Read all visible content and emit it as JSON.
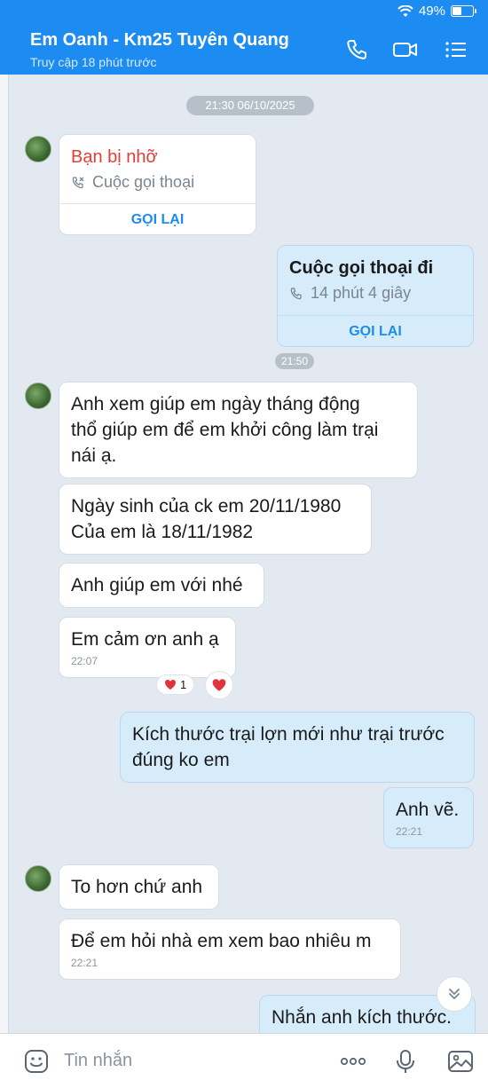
{
  "status": {
    "battery": "49%",
    "battery_level": 0.49
  },
  "header": {
    "title": "Em Oanh - Km25 Tuyên Quang",
    "subtitle": "Truy cập 18 phút trước",
    "icons": [
      "phone-icon",
      "video-icon",
      "menu-icon"
    ]
  },
  "chat": {
    "date_pill": "21:30 06/10/2025",
    "missed_call": {
      "title": "Bạn bị nhỡ",
      "sub": "Cuộc gọi thoại",
      "action": "GỌI LẠI"
    },
    "outgoing_call": {
      "title": "Cuộc gọi thoại đi",
      "sub": "14 phút 4 giây",
      "action": "GỌI LẠI"
    },
    "time_pill": "21:50",
    "messages": [
      {
        "dir": "in",
        "text_lines": [
          "Anh xem giúp em ngày tháng động",
          "thổ giúp em để em khởi công làm trại",
          "nái ạ."
        ]
      },
      {
        "dir": "in",
        "text_lines": [
          "Ngày sinh của ck em 20/11/1980",
          "Của em là 18/11/1982"
        ]
      },
      {
        "dir": "in",
        "text_lines": [
          "Anh giúp em với nhé"
        ]
      },
      {
        "dir": "in",
        "text_lines": [
          "Em cảm ơn anh ạ"
        ],
        "time": "22:07"
      },
      {
        "dir": "out",
        "text_lines": [
          "Kích thước trại lợn mới như trại trước",
          "đúng ko em"
        ]
      },
      {
        "dir": "out",
        "text_lines": [
          "Anh vẽ."
        ],
        "time": "22:21"
      },
      {
        "dir": "in",
        "text_lines": [
          "To hơn chứ anh"
        ]
      },
      {
        "dir": "in",
        "text_lines": [
          "Để em hỏi nhà em xem bao nhiêu m"
        ],
        "time": "22:21"
      },
      {
        "dir": "out",
        "text_lines": [
          "Nhắn anh kích thước."
        ]
      }
    ],
    "reaction": {
      "count": "1",
      "icon": "heart-icon"
    }
  },
  "input_bar": {
    "placeholder": "Tin nhắn",
    "icons": [
      "emoji-icon",
      "more-icon",
      "mic-icon",
      "image-icon"
    ]
  },
  "colors": {
    "brand": "#1d8cf2",
    "missed": "#e33d3a",
    "out_bubble": "#d6ecfb",
    "background": "#e2e9f1"
  }
}
